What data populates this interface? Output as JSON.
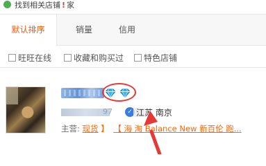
{
  "top_strip": {
    "text": "找到相关店铺",
    "bang": "!",
    "tail": "家"
  },
  "sort_bar": {
    "tabs": [
      {
        "label": "默认排序",
        "active": true
      },
      {
        "label": "销量",
        "active": false
      },
      {
        "label": "信用",
        "active": false
      }
    ]
  },
  "filters": [
    {
      "label": "旺旺在线",
      "checked": false
    },
    {
      "label": "收藏和购买过",
      "checked": false
    },
    {
      "label": "特色店铺",
      "checked": false
    }
  ],
  "shop": {
    "name": "",
    "level_icons": [
      "diamond-icon",
      "diamond-icon"
    ],
    "seller_suffix": "97",
    "location": "江苏 南京",
    "main_label": "主营:",
    "main_products_1": "现货",
    "main_products_2": "【 海 淘 Balance New 新百伦 跑...",
    "sep": "】"
  },
  "colors": {
    "accent": "#ff5500",
    "annotation": "#e53935",
    "diamond": "#29b6f6"
  }
}
